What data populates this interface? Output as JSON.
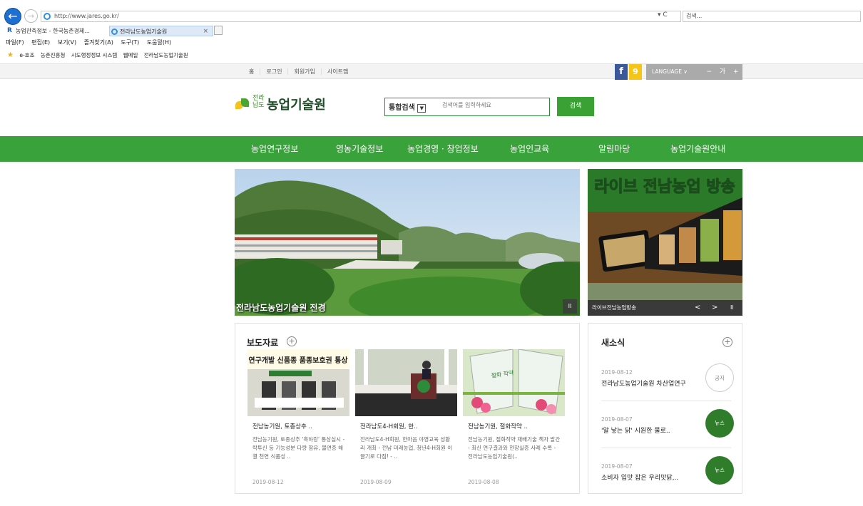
{
  "browser": {
    "url": "http://www.jares.go.kr/",
    "search_placeholder": "검색...",
    "addr_tools": "▾ C",
    "tabs": [
      {
        "title": "농업관측정보 - 한국농촌경제..."
      },
      {
        "title": "전라남도농업기술원",
        "close": "×"
      }
    ],
    "menu": [
      "파일(F)",
      "편집(E)",
      "보기(V)",
      "즐겨찾기(A)",
      "도구(T)",
      "도움말(H)"
    ],
    "favorites": [
      "e-호조",
      "농촌진흥청",
      "시도행정정보 시스템",
      "웹메일",
      "전라남도농업기술원"
    ]
  },
  "topbar": {
    "links": [
      "홈",
      "로그인",
      "회원가입",
      "사이트맵"
    ],
    "facebook": "f",
    "kakao": "9",
    "language": "LANGUAGE ∨",
    "font_minus": "−",
    "font_label": "가",
    "font_plus": "+"
  },
  "header": {
    "logo_small": "전라남도",
    "logo_text": "농업기술원",
    "search_category": "통합검색",
    "search_placeholder": "검색어를 입력하세요",
    "search_button": "검색"
  },
  "gnb": [
    "농업연구정보",
    "영농기술정보",
    "농업경영 · 창업정보",
    "농업인교육",
    "알림마당",
    "농업기술원안내"
  ],
  "main_visual": {
    "caption": "전라남도농업기술원 전경",
    "pause": "II"
  },
  "live": {
    "banner": "라이브 전남농업 방송",
    "label": "라이브전남농업방송",
    "prev": "<",
    "next": ">",
    "pause": "II"
  },
  "press": {
    "title": "보도자료",
    "more": "+",
    "cards": [
      {
        "title": "전남농기원, 토종상추 ..",
        "desc": "전남농기원, 토종상추 '흑하랑' 통상실시 - 락투신 등 기능성분 다량 함유, 불면증 해결 천연 식품성 ..",
        "date": "2019-08-12",
        "thumb_text": "연구개발 신품종 품종보호권 통상"
      },
      {
        "title": "전라남도4-H회원, 한..",
        "desc": "전라남도4-H회원, 한마음 야영교육 성황리 개최 - 전남 미래농업, 청년4-H회원 이끌기로 다짐! - ..",
        "date": "2019-08-09"
      },
      {
        "title": "전남농기원, 절화작약 ..",
        "desc": "전남농기원, 절화작약 재배기술 책자 발간 - 최신 연구결과와 현장실증 사례 수록 - 전라남도농업기술원(..",
        "date": "2019-08-08",
        "thumb_text": "절화 작약"
      }
    ]
  },
  "news": {
    "title": "새소식",
    "more": "+",
    "items": [
      {
        "date": "2019-08-12",
        "text": "전라남도농업기술원 차산업연구",
        "badge": "공지"
      },
      {
        "date": "2019-08-07",
        "text": "'알 낳는 닭' 시원한 물로..",
        "badge": "뉴스"
      },
      {
        "date": "2019-08-07",
        "text": "소비자 입맛 잡은 우리맛닭,..",
        "badge": "뉴스"
      }
    ]
  },
  "colors": {
    "brand_green": "#39a23a",
    "dark_green": "#2f7d2a",
    "facebook": "#3b5998",
    "kakao": "#f5c518"
  }
}
